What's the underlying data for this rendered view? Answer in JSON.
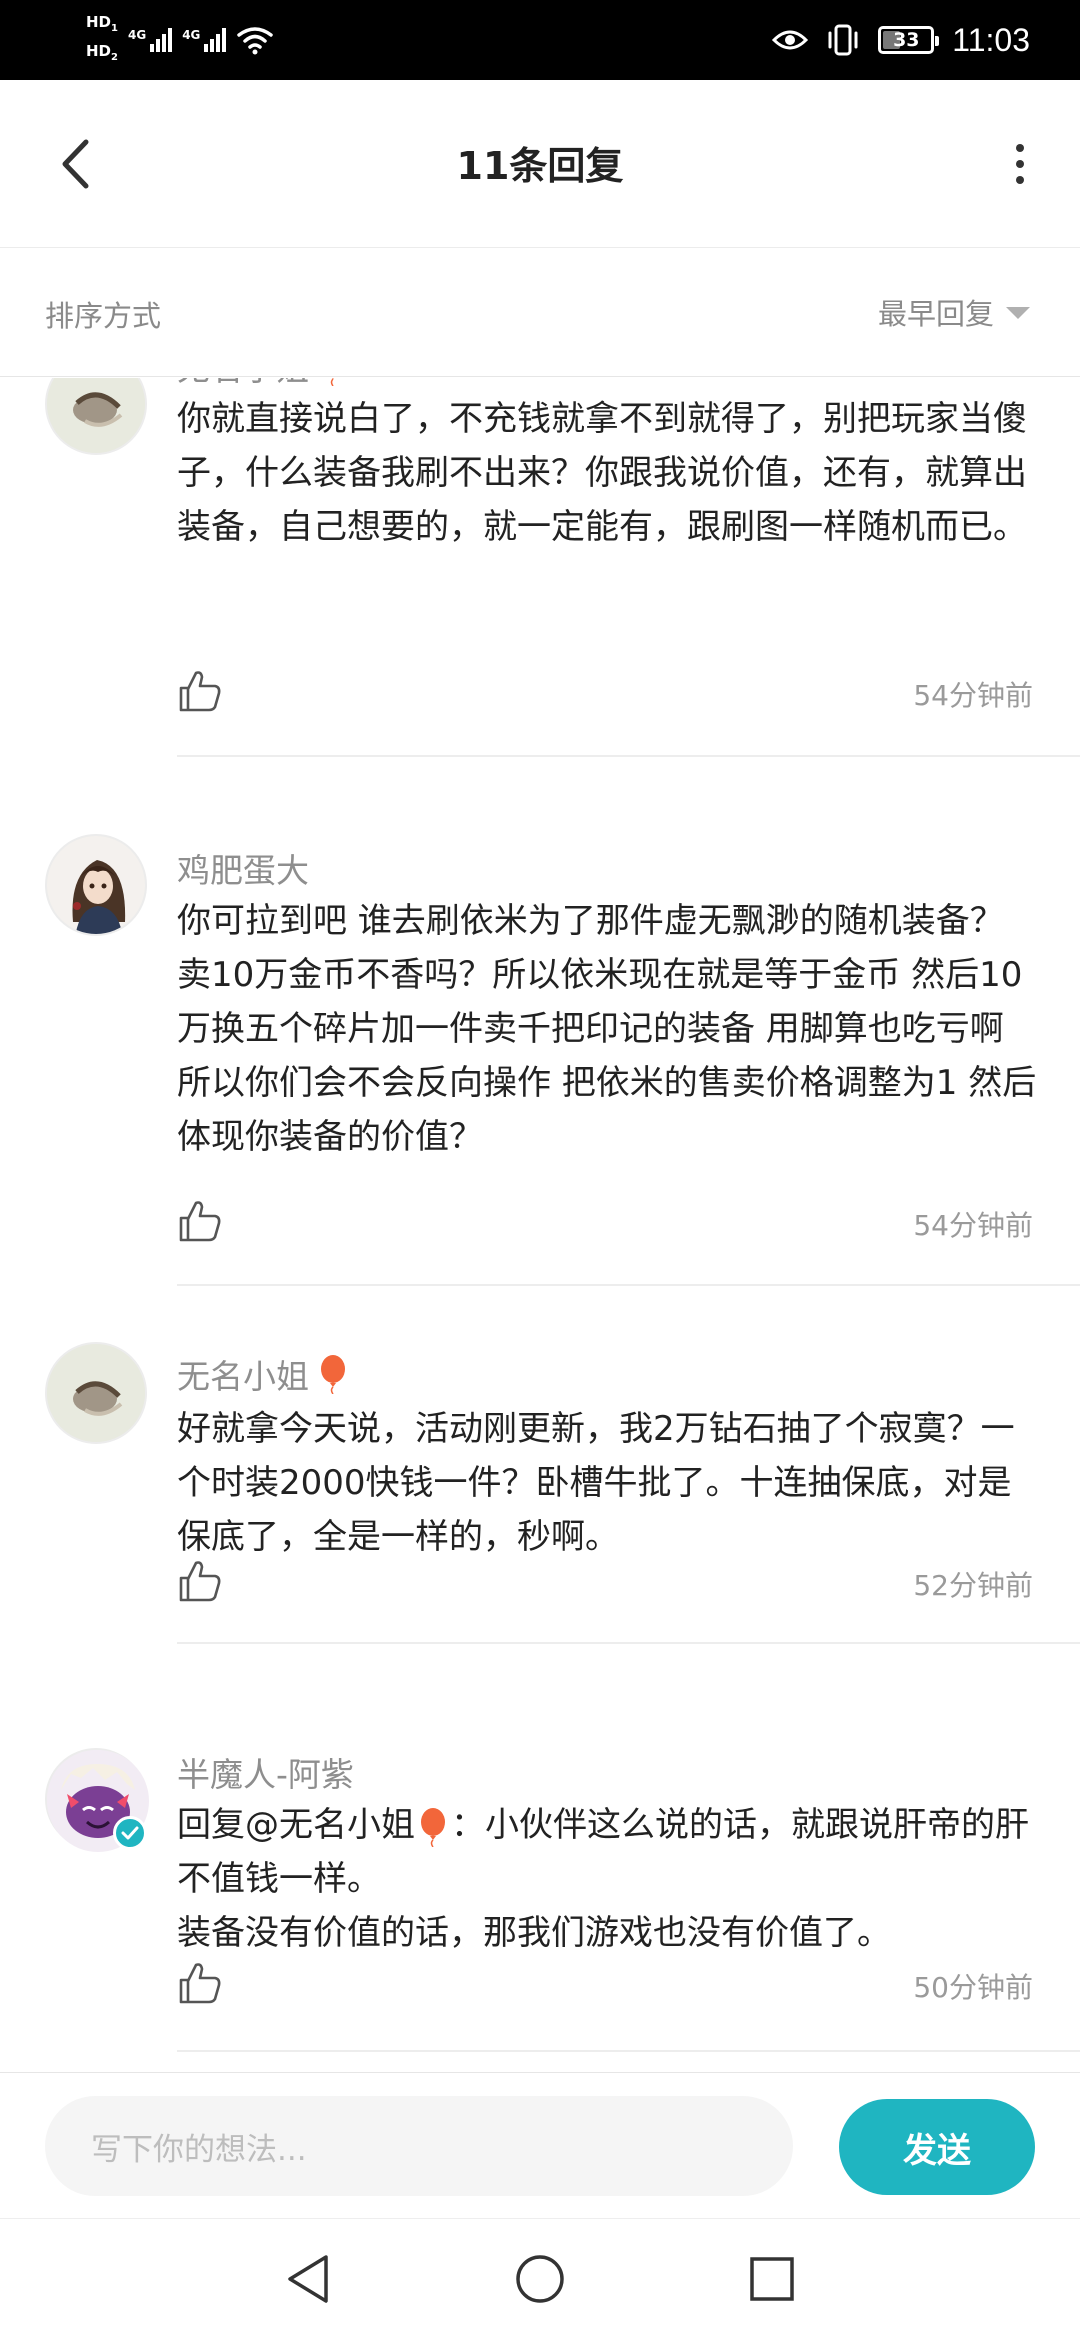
{
  "status_bar": {
    "hd_top": "HD",
    "hd_top_sub": "1",
    "hd_bottom": "HD",
    "hd_bottom_sub": "2",
    "network_1": "4G",
    "network_2": "4G",
    "battery_level": "33",
    "battery_fraction": 0.33,
    "time": "11:03",
    "icons": [
      "eye-icon",
      "vibrate-icon",
      "wifi-icon",
      "signal-icon",
      "battery-icon"
    ]
  },
  "header": {
    "title": "11条回复",
    "back_icon": "chevron-left-icon",
    "more_icon": "more-vertical-icon"
  },
  "sort": {
    "label": "排序方式",
    "selected": "最早回复"
  },
  "comments": [
    {
      "username": "无名小姐",
      "badge": "balloon-icon",
      "text": "你就直接说白了，不充钱就拿不到就得了，别把玩家当傻子，什么装备我刷不出来？你跟我说价值，还有，就算出装备，自己想要的，就一定能有，跟刷图一样随机而已。",
      "time": "54分钟前"
    },
    {
      "username": "鸡肥蛋大",
      "text": "你可拉到吧 谁去刷依米为了那件虚无飘渺的随机装备？卖10万金币不香吗？所以依米现在就是等于金币 然后10万换五个碎片加一件卖千把印记的装备 用脚算也吃亏啊 所以你们会不会反向操作 把依米的售卖价格调整为1 然后体现你装备的价值？",
      "time": "54分钟前"
    },
    {
      "username": "无名小姐",
      "badge": "balloon-icon",
      "text": "好就拿今天说，活动刚更新，我2万钻石抽了个寂寞？一个时装2000快钱一件？卧槽牛批了。十连抽保底，对是保底了，全是一样的，秒啊。",
      "time": "52分钟前"
    },
    {
      "username": "半魔人-阿紫",
      "verified": true,
      "reply_prefix": "回复",
      "reply_mention": "@无名小姐",
      "reply_colon": "：",
      "text_part1": "小伙伴这么说的话，就跟说肝帝的肝不值钱一样。",
      "text_part2": "装备没有价值的话，那我们游戏也没有价值了。",
      "time": "50分钟前"
    }
  ],
  "input": {
    "placeholder": "写下你的想法...",
    "send_label": "发送"
  },
  "colors": {
    "accent": "#1fb5c1",
    "text": "#222222",
    "muted": "#8e8e8e",
    "divider": "#ededed"
  },
  "nav": {
    "icons": [
      "back-triangle-icon",
      "home-circle-icon",
      "recents-square-icon"
    ]
  }
}
